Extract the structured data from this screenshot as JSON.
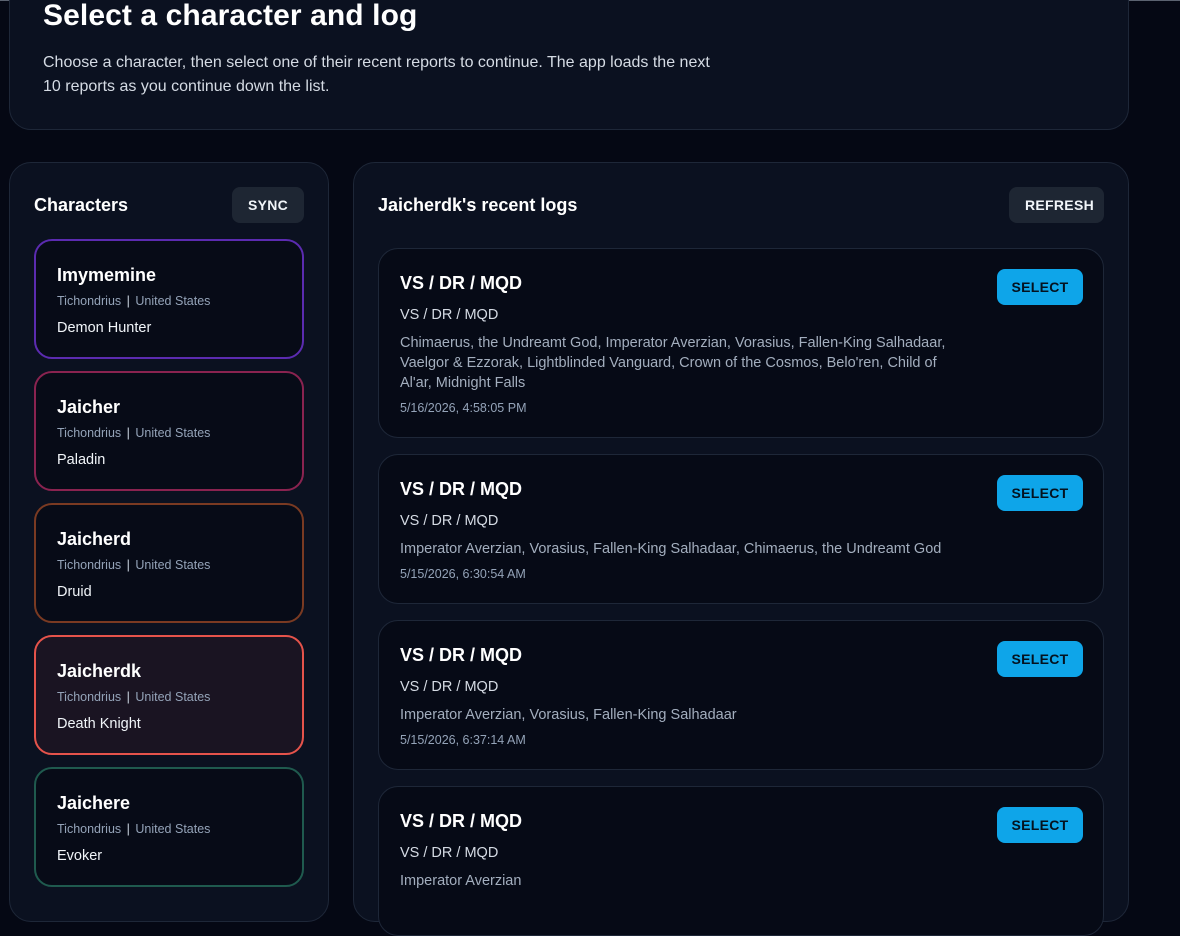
{
  "header": {
    "title": "Select a character and log",
    "description": "Choose a character, then select one of their recent reports to continue. The app loads the next 10 reports as you continue down the list."
  },
  "characters_panel": {
    "title": "Characters",
    "sync_label": "SYNC",
    "items": [
      {
        "name": "Imymemine",
        "realm": "Tichondrius",
        "separator": "|",
        "region": "United States",
        "class": "Demon Hunter",
        "border_color": "#5b2bb0",
        "selected": false
      },
      {
        "name": "Jaicher",
        "realm": "Tichondrius",
        "separator": "|",
        "region": "United States",
        "class": "Paladin",
        "border_color": "#8a2350",
        "selected": false
      },
      {
        "name": "Jaicherd",
        "realm": "Tichondrius",
        "separator": "|",
        "region": "United States",
        "class": "Druid",
        "border_color": "#7a3a22",
        "selected": false
      },
      {
        "name": "Jaicherdk",
        "realm": "Tichondrius",
        "separator": "|",
        "region": "United States",
        "class": "Death Knight",
        "border_color": "#e5534b",
        "selected": true
      },
      {
        "name": "Jaichere",
        "realm": "Tichondrius",
        "separator": "|",
        "region": "United States",
        "class": "Evoker",
        "border_color": "#1f5a4e",
        "selected": false
      }
    ]
  },
  "logs_panel": {
    "title": "Jaicherdk's recent logs",
    "refresh_label": "REFRESH",
    "select_label": "SELECT",
    "items": [
      {
        "title": "VS / DR / MQD",
        "subtitle": "VS / DR / MQD",
        "bosses": "Chimaerus, the Undreamt God, Imperator Averzian, Vorasius, Fallen-King Salhadaar, Vaelgor & Ezzorak, Lightblinded Vanguard, Crown of the Cosmos, Belo'ren, Child of Al'ar, Midnight Falls",
        "date": "5/16/2026, 4:58:05 PM"
      },
      {
        "title": "VS / DR / MQD",
        "subtitle": "VS / DR / MQD",
        "bosses": "Imperator Averzian, Vorasius, Fallen-King Salhadaar, Chimaerus, the Undreamt God",
        "date": "5/15/2026, 6:30:54 AM"
      },
      {
        "title": "VS / DR / MQD",
        "subtitle": "VS / DR / MQD",
        "bosses": "Imperator Averzian, Vorasius, Fallen-King Salhadaar",
        "date": "5/15/2026, 6:37:14 AM"
      },
      {
        "title": "VS / DR / MQD",
        "subtitle": "VS / DR / MQD",
        "bosses": "Imperator Averzian",
        "date": ""
      }
    ]
  },
  "colors": {
    "accent": "#0ea5e9",
    "background": "#050814",
    "panel": "#0b1120",
    "selected_card_bg": "#1a1422"
  }
}
